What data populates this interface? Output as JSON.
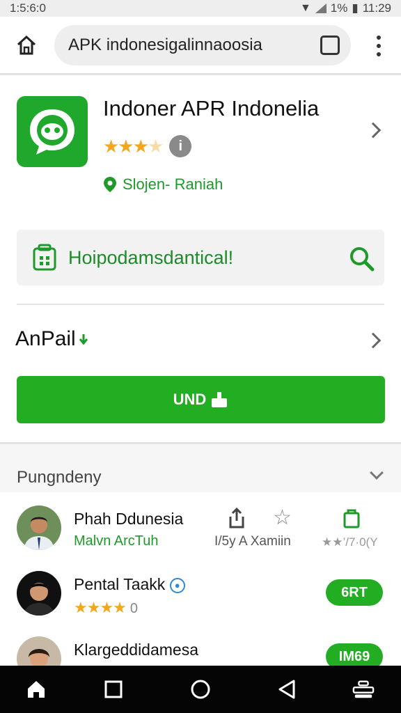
{
  "status_bar": {
    "time_left": "1:5:6:0",
    "battery_text": "1%",
    "time_right": "11:29"
  },
  "browser": {
    "url": "APK indonesigalinnaoosia",
    "tabs_count": ""
  },
  "app": {
    "title": "Indoner APR Indonelia",
    "rating_stars": 3,
    "info_label": "i",
    "location": "Slojen- Raniah"
  },
  "search": {
    "text": "Hoipodamsdantical!"
  },
  "section": {
    "title": "AnPail"
  },
  "install": {
    "label": "UND"
  },
  "band": {
    "title": "Pungndeny"
  },
  "list": [
    {
      "name": "Phah Ddunesia",
      "sub": "Malvn ArcTuh",
      "action_mid": "I/5y A Xamiin",
      "action_right": "★★’/7·0(Y"
    },
    {
      "name": "Pental Taakk",
      "stars": "★★★★",
      "count": "0",
      "button": "6RT"
    },
    {
      "name": "Klargeddidamesa",
      "button": "IM69"
    }
  ],
  "colors": {
    "accent": "#22ad22",
    "accent_text": "#1e9a2a",
    "star": "#f2a81d"
  }
}
